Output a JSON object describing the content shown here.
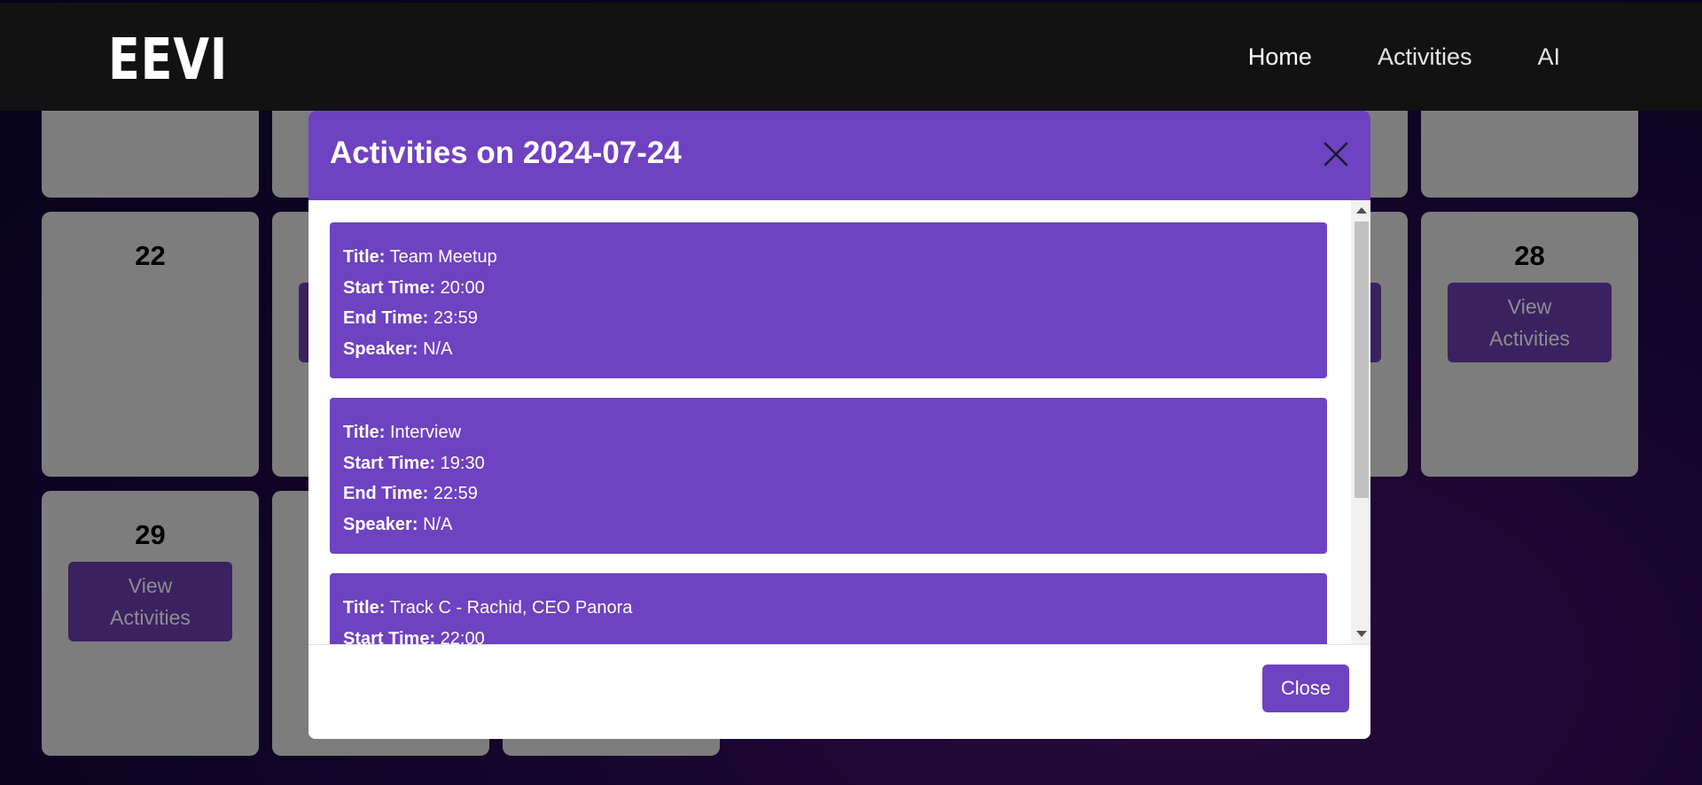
{
  "navbar": {
    "logo": "EEVI",
    "links": [
      {
        "label": "Home"
      },
      {
        "label": "Activities"
      },
      {
        "label": "AI"
      }
    ]
  },
  "calendar": {
    "days": [
      {
        "day": "22",
        "has_button": false
      },
      {
        "day": "28",
        "has_button": true
      },
      {
        "day": "29",
        "has_button": true
      }
    ],
    "view_button_label": "View\nActivities"
  },
  "modal": {
    "title": "Activities on 2024-07-24",
    "activities": [
      {
        "title": "Team Meetup",
        "start": "20:00",
        "end": "23:59",
        "speaker": "N/A"
      },
      {
        "title": "Interview",
        "start": "19:30",
        "end": "22:59",
        "speaker": "N/A"
      },
      {
        "title": "Track C - Rachid, CEO Panora",
        "start": "22:00",
        "end": "",
        "speaker": ""
      }
    ],
    "labels": {
      "title": "Title:",
      "start": "Start Time:",
      "end": "End Time:",
      "speaker": "Speaker:"
    },
    "close_label": "Close"
  },
  "colors": {
    "accent": "#6f42c1",
    "navbar_bg": "#121212",
    "cell_bg": "#7d7d7d"
  }
}
